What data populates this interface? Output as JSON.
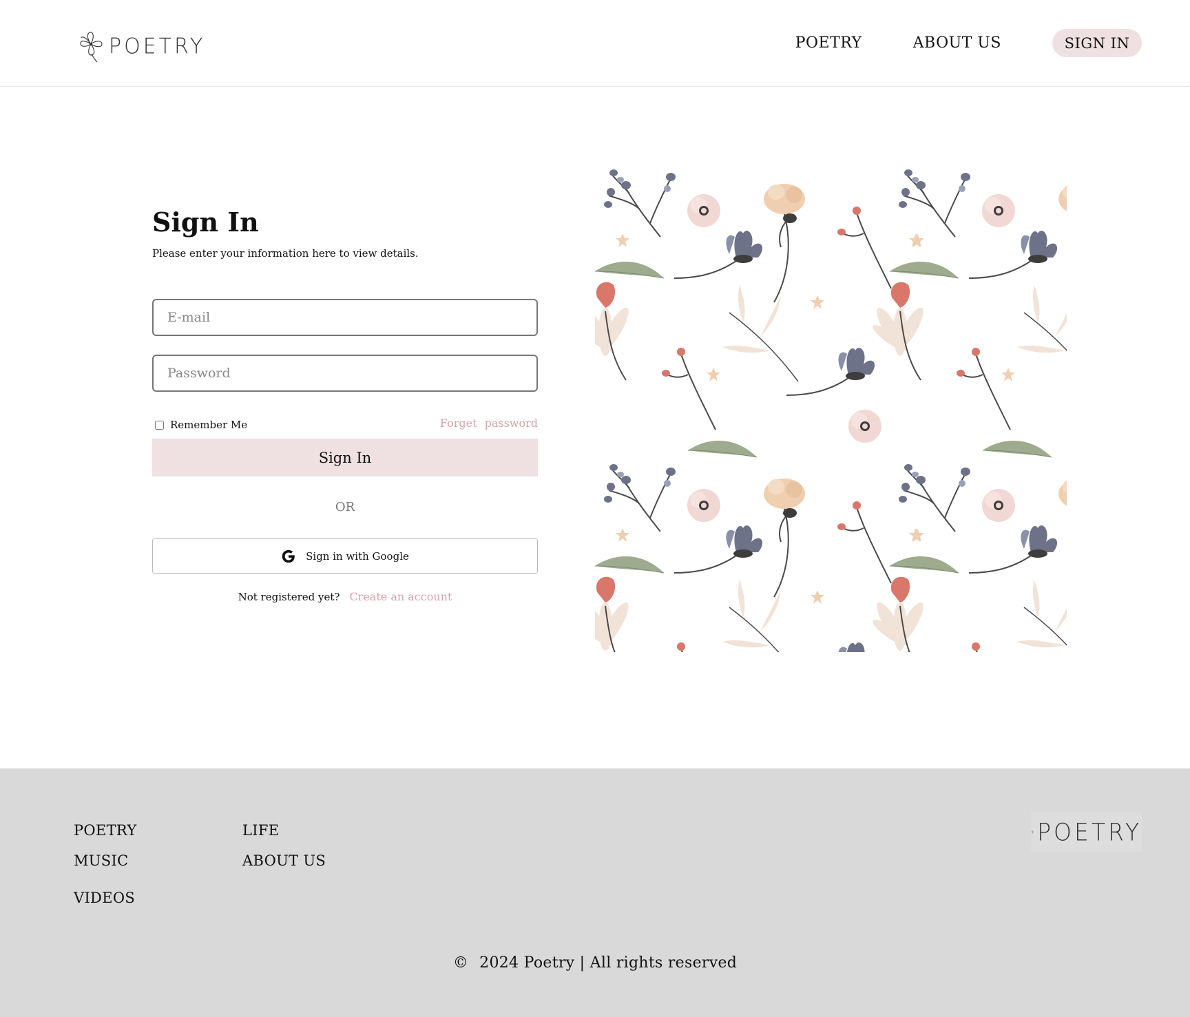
{
  "header": {
    "logo_text": "POETRY",
    "nav": {
      "poetry": "POETRY",
      "about": "ABOUT US",
      "signin": "SIGN IN"
    }
  },
  "form": {
    "title": "Sign In",
    "subtitle": "Please enter your information here to view details.",
    "email_placeholder": "E-mail",
    "password_placeholder": "Password",
    "remember_label": "Remember Me",
    "forgot_label": "Forget password",
    "signin_button": "Sign In",
    "or_text": "OR",
    "google_button": "Sign in with Google",
    "register_prompt": "Not registered yet?",
    "register_link": "Create an account"
  },
  "footer": {
    "links": {
      "poetry": "POETRY",
      "music": "MUSIC",
      "videos": "VIDEOS",
      "life": "LIFE",
      "about": "ABOUT US"
    },
    "logo_text": "POETRY",
    "copyright_symbol": "©",
    "copyright_text": "2024 Poetry | All rights reserved"
  },
  "colors": {
    "accent_pink": "#efe1e2",
    "link_pink": "#d4a4a8",
    "footer_bg": "#d9d9d9"
  },
  "icons": [
    "flower-logo-icon",
    "google-g-icon"
  ]
}
